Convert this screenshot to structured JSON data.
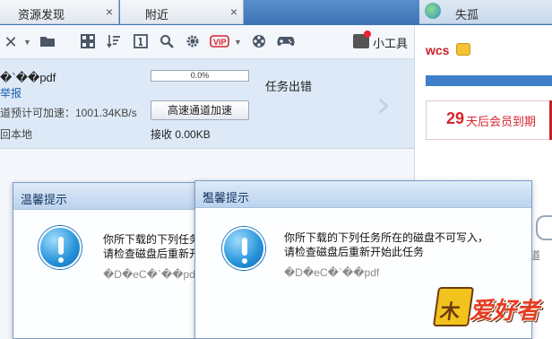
{
  "tabs": [
    {
      "label": "资源发现",
      "close": "×"
    },
    {
      "label": "附近",
      "close": "×"
    }
  ],
  "right_tab": {
    "label": "失孤",
    "icon": "app-logo-icon"
  },
  "toolbar": {
    "icons": [
      "close-icon",
      "caret-down-icon",
      "folder-icon",
      "grid-icon",
      "sort-icon",
      "info-box-icon",
      "search-icon",
      "gear-icon",
      "vip-icon",
      "caret-down-icon",
      "film-reel-icon",
      "gamepad-icon"
    ],
    "tools_label": "小工具"
  },
  "download": {
    "filename": "�`��pdf",
    "report_link": "举报",
    "speed_text": "道预计可加速：1001.34KB/s",
    "local_text": "回本地",
    "progress_text": "0.0%",
    "progress": 0.0,
    "accelerate_button": "高速通道加速",
    "received": "接收 0.00KB",
    "status": "任务出错"
  },
  "right_panel": {
    "username": "wcs",
    "days": "29",
    "days_suffix": "天后会员到期",
    "fragment": "道"
  },
  "dialog_back": {
    "title": "温馨提示",
    "line1": "你所下载的下列任务",
    "line2": "请检查磁盘后重新开",
    "file": "�D�eC�`��pdf"
  },
  "dialog_front": {
    "title": "温馨提示",
    "close": "×",
    "line1": "你所下载的下列任务所在的磁盘不可写入，",
    "line2": "请检查磁盘后重新开始此任务",
    "file": "�D�eC�`��pdf"
  },
  "watermark": {
    "text1": "木",
    "text2": "爱好者"
  }
}
